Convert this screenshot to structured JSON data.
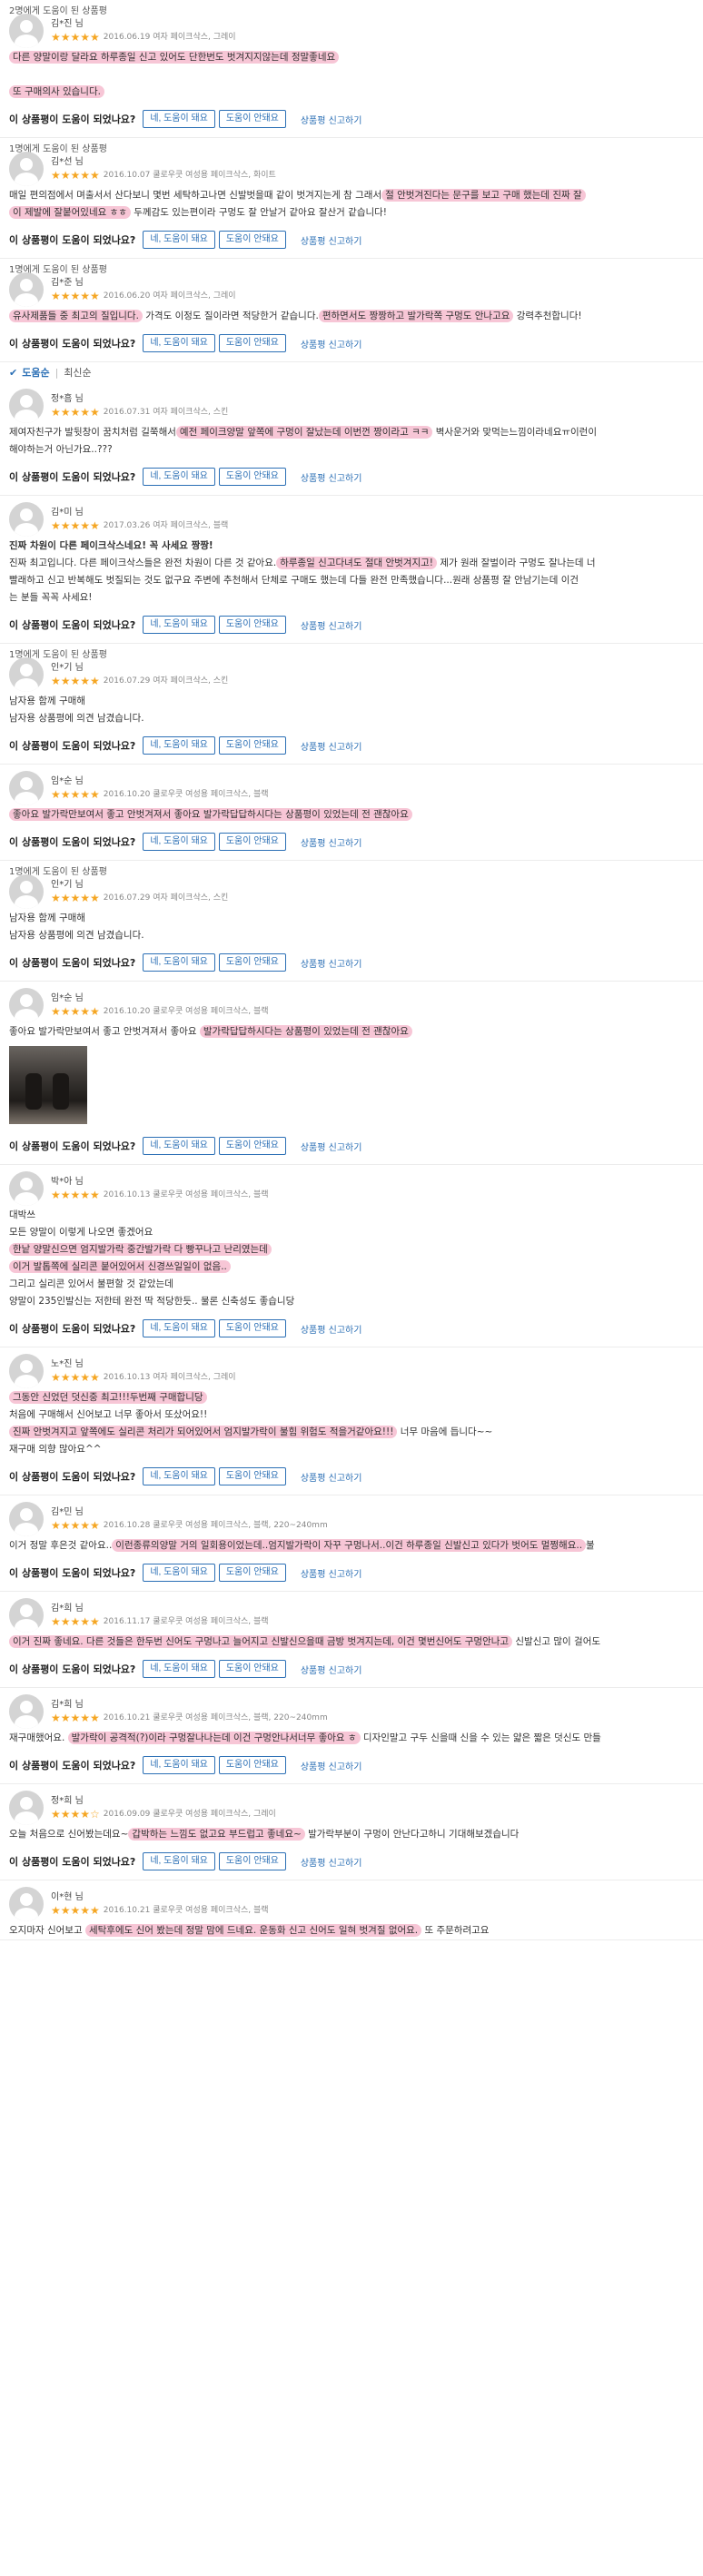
{
  "question": "이 상품평이 도움이 되었나요?",
  "btn_yes": "네, 도움이 돼요",
  "btn_no": "도움이 안돼요",
  "report": "상품평 신고하기",
  "sort": {
    "active": "도움순",
    "separator": "|",
    "other": "최신순"
  },
  "stars_label": "★★★★★",
  "colors": {
    "accent": "#2b6fb5",
    "star": "#f5a623",
    "highlight": "#f7c6d6"
  },
  "reviews": [
    {
      "helpful": "2명에게 도움이 된 상품평",
      "name": "김*진 님",
      "stars": "★★★★★",
      "meta": "2016.06.19  여자 페이크삭스, 그레이",
      "lines": [
        [
          {
            "t": "다른 양말이랑 달라요 하루종일 신고 있어도 단한번도 벗겨지지않는데 정말좋네요",
            "h": true
          }
        ],
        [],
        [
          {
            "t": "또 구매의사 있습니다.",
            "h": true
          }
        ]
      ]
    },
    {
      "helpful": "1명에게 도움이 된 상품평",
      "name": "김*선 님",
      "stars": "★★★★★",
      "meta": "2016.10.07  쿨로우쿳 여성용 페이크삭스, 화이트",
      "lines": [
        [
          {
            "t": "매일 편의점에서 며출서서 산다보니 몇번 세탁하고나면 신발벗을때 같이 벗겨지는게 참 그래서",
            "h": false
          },
          {
            "t": "절 안벗겨진다는 문구를 보고 구매 했는데 진짜 잘",
            "h": true
          }
        ],
        [
          {
            "t": "이 제발에 잘붙어있네요 ㅎㅎ",
            "h": true
          },
          {
            "t": " 두께감도 있는편이라 구멍도 잘 안날거 같아요 잘산거 같습니다!",
            "h": false
          }
        ]
      ]
    },
    {
      "helpful": "1명에게 도움이 된 상품평",
      "name": "김*준 님",
      "stars": "★★★★★",
      "meta": "2016.06.20  여자 페이크삭스, 그레이",
      "lines": [
        [
          {
            "t": "유사제품들 중 최고의 질입니다.",
            "h": true
          },
          {
            "t": " 가격도 이정도 질이라면 적당한거 같습니다.",
            "h": false
          },
          {
            "t": "편하면서도 짱짱하고 발가락쪽 구멍도 안나고요",
            "h": true
          },
          {
            "t": " 강력추천합니다!",
            "h": false
          }
        ]
      ]
    },
    {
      "sort_after": true,
      "helpful": "",
      "name": "정*흠 님",
      "stars": "★★★★★",
      "meta": "2016.07.31  여자 페이크삭스, 스킨",
      "lines": [
        [
          {
            "t": "제여자친구가 발뒷창이 꿈치처럼 길쭉해서",
            "h": false
          },
          {
            "t": "예전 페이크양말 앞쪽에 구멍이 잘났는데 이번껀 짱이라고 ㅋㅋ",
            "h": true
          },
          {
            "t": " 벽사운거와 맞먹는느낌이라네요ㅠ이런이",
            "h": false
          }
        ],
        [
          {
            "t": "해야하는거 아닌가요..???",
            "h": false
          }
        ]
      ]
    },
    {
      "helpful": "",
      "name": "김*미 님",
      "stars": "★★★★★",
      "meta": "2017.03.26  여자 페이크삭스, 블랙",
      "bold_title": "진짜 차원이 다른 페이크삭스네요! 꼭 사세요 짱짱!",
      "lines": [
        [
          {
            "t": "진짜 최고입니다. 다른 페이크삭스들은 완전 차원이 다른 것 같아요.",
            "h": false
          },
          {
            "t": "하루종일 신고다녀도 절대 안벗겨지고!",
            "h": true
          },
          {
            "t": " 제가 원래 잘벌이라 구멍도 잘나는데 너",
            "h": false
          }
        ],
        [
          {
            "t": "빨래하고 신고 반복해도 벗질되는 것도 없구요 주변에 추천해서 단체로 구매도 했는데 다들 완전 만족했습니다...원래 상품평 잘 안남기는데 이건",
            "h": false
          }
        ],
        [
          {
            "t": "는 분들 꼭꼭 사세요!",
            "h": false
          }
        ]
      ]
    },
    {
      "helpful": "1명에게 도움이 된 상품평",
      "name": "인*기 님",
      "stars": "★★★★★",
      "meta": "2016.07.29  여자 페이크삭스, 스킨",
      "lines": [
        [
          {
            "t": "남자용 함께 구매해",
            "h": false
          }
        ],
        [
          {
            "t": "남자용 상품평에 의견 남겼습니다.",
            "h": false
          }
        ]
      ]
    },
    {
      "helpful": "",
      "name": "임*순 님",
      "stars": "★★★★★",
      "meta": "2016.10.20  쿨로우쿳 여성용 페이크삭스, 블랙",
      "lines": [
        [
          {
            "t": "좋아요 발가락만보여서 좋고 안벗겨져서 좋아요 발가락답답하시다는 상품평이 있었는데 전 괜찮아요",
            "h": true
          }
        ]
      ]
    },
    {
      "helpful": "1명에게 도움이 된 상품평",
      "name": "인*기 님",
      "stars": "★★★★★",
      "meta": "2016.07.29  여자 페이크삭스, 스킨",
      "lines": [
        [
          {
            "t": "남자용 함께 구매해",
            "h": false
          }
        ],
        [
          {
            "t": "남자용 상품평에 의견 남겼습니다.",
            "h": false
          }
        ]
      ]
    },
    {
      "helpful": "",
      "name": "임*순 님",
      "stars": "★★★★★",
      "meta": "2016.10.20  쿨로우쿳 여성용 페이크삭스, 블랙",
      "photo": true,
      "lines": [
        [
          {
            "t": "좋아요 발가락만보여서 좋고 안벗겨져서 좋아요 ",
            "h": false
          },
          {
            "t": "발가락답답하시다는 상품평이 있었는데 전 괜찮아요",
            "h": true
          }
        ]
      ]
    },
    {
      "helpful": "",
      "name": "박*아 님",
      "stars": "★★★★★",
      "meta": "2016.10.13  쿨로우쿳 여성용 페이크삭스, 블랙",
      "lines": [
        [
          {
            "t": "대박쓰",
            "h": false
          }
        ],
        [
          {
            "t": "모든 양말이 이렇게 나오면 좋겠어요",
            "h": false
          }
        ],
        [
          {
            "t": "한낱 양말신으면 엄지발가락 중간발가락 다 빵꾸나고 난리였는데",
            "h": true
          }
        ],
        [
          {
            "t": "이거 발톱쪽에 실리콘 붙어있어서 신경쓰일일이 없음..",
            "h": true
          }
        ],
        [
          {
            "t": "그리고 실리콘 있어서 불편할 것 같았는데",
            "h": false
          }
        ],
        [
          {
            "t": "양말이 235인발신는 저한테 완전 딱 적당한듯.. 물론 신축성도 좋습니당",
            "h": false
          }
        ]
      ]
    },
    {
      "helpful": "",
      "name": "노*진 님",
      "stars": "★★★★★",
      "meta": "2016.10.13  여자 페이크삭스, 그레이",
      "lines": [
        [
          {
            "t": "그동안 신었던 덧신중 최고!!!두번째 구매합니당",
            "h": true
          }
        ],
        [
          {
            "t": "처음에 구매해서 신어보고 너무 좋아서 또샀어요!!",
            "h": false
          }
        ],
        [
          {
            "t": "진짜 안벗겨지고 앞쪽에도 실리콘 처리가 되어있어서 엄지발가락이 불힘 위험도 적을거같아요!!!",
            "h": true
          },
          {
            "t": " 너무 마음에 듭니다~~",
            "h": false
          }
        ],
        [
          {
            "t": "재구매 의향 많아요^^",
            "h": false
          }
        ]
      ]
    },
    {
      "helpful": "",
      "name": "김*민 님",
      "stars": "★★★★★",
      "meta": "2016.10.28  쿨로우쿳 여성용 페이크삭스, 블랙, 220~240mm",
      "lines": [
        [
          {
            "t": "이거 정말 후은것 같아요..",
            "h": false
          },
          {
            "t": "이런종류의양말 거의 일회용이었는데..엄지발가락이 자꾸 구멍나서..이건 하루종일 신발신고 있다가 벗어도 멀쩡해요..",
            "h": true
          },
          {
            "t": "불",
            "h": false
          }
        ]
      ]
    },
    {
      "helpful": "",
      "name": "김*희 님",
      "stars": "★★★★★",
      "meta": "2016.11.17  쿨로우쿳 여성용 페이크삭스, 블랙",
      "lines": [
        [
          {
            "t": "이거 진짜 좋네요. 다른 것들은 한두번 신어도 구멍나고 늘어지고 신발신으을때 금방 벗겨지는데, 이건 몇번신어도 구멍안나고",
            "h": true
          },
          {
            "t": " 신발신고 많이 걸어도",
            "h": false
          }
        ]
      ]
    },
    {
      "helpful": "",
      "name": "김*희 님",
      "stars": "★★★★★",
      "meta": "2016.10.21  쿨로우쿳 여성용 페이크삭스, 블랙, 220~240mm",
      "lines": [
        [
          {
            "t": "재구매했어요. ",
            "h": false
          },
          {
            "t": "발가락이 공격적(?)이라 구멍잘나나는데 이건 구멍안나서너무 좋아요 ㅎ",
            "h": true
          },
          {
            "t": " 디자인말고 구두 신을때 신을 수 있는 얇은 짧은 덧신도 만들",
            "h": false
          }
        ]
      ]
    },
    {
      "helpful": "",
      "name": "정*희 님",
      "stars": "★★★★☆",
      "meta": "2016.09.09  쿨로우쿳 여성용 페이크삭스, 그레이",
      "lines": [
        [
          {
            "t": "오늘 처음으로 신어봤는데요~",
            "h": false
          },
          {
            "t": "갑박하는 느낌도 없고요 부드럽고 좋네요~",
            "h": true
          },
          {
            "t": " 발가락부분이 구멍이 안난다고하니 기대해보겠습니다",
            "h": false
          }
        ]
      ]
    },
    {
      "helpful": "",
      "name": "이*현 님",
      "stars": "★★★★★",
      "meta": "2016.10.21  쿨로우쿳 여성용 페이크삭스, 블랙",
      "no_question": true,
      "lines": [
        [
          {
            "t": "오지마자 신어보고 ",
            "h": false
          },
          {
            "t": "세탁후에도 신어 봤는데 정말 맘에 드네요. 운동화 신고 신어도 일혀 벗겨질 없어요.",
            "h": true
          },
          {
            "t": " 또 주문하려고요",
            "h": false
          }
        ]
      ]
    }
  ]
}
